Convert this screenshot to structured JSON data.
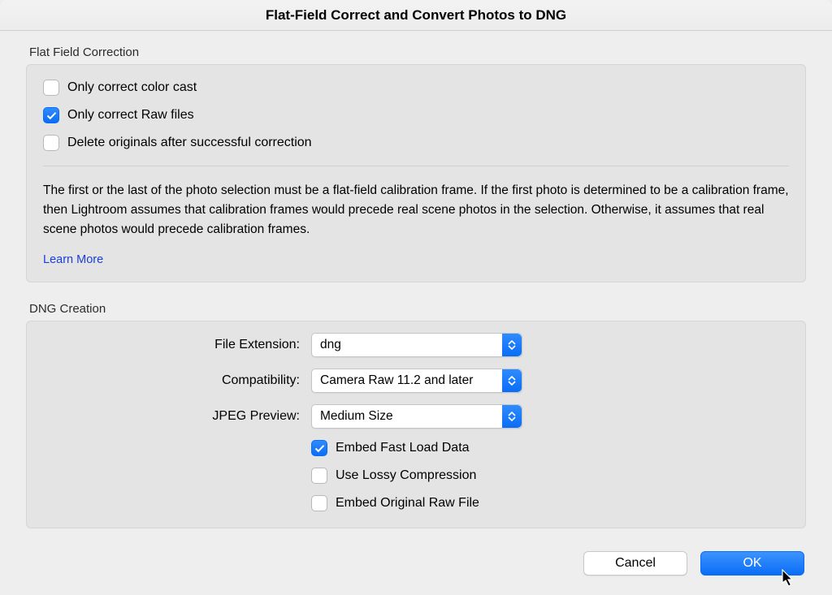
{
  "window": {
    "title": "Flat-Field Correct and Convert Photos to DNG"
  },
  "flat_field": {
    "group_label": "Flat Field Correction",
    "only_color_cast": {
      "label": "Only correct color cast",
      "checked": false
    },
    "only_raw": {
      "label": "Only correct Raw files",
      "checked": true
    },
    "delete_originals": {
      "label": "Delete originals after successful correction",
      "checked": false
    },
    "info": "The first or the last of the photo selection must be a flat-field calibration frame. If the first photo is determined to be a calibration frame, then Lightroom assumes that calibration frames would precede real scene photos in the selection. Otherwise, it assumes that real scene photos would precede calibration frames.",
    "learn_more": "Learn More"
  },
  "dng": {
    "group_label": "DNG Creation",
    "file_extension": {
      "label": "File Extension:",
      "value": "dng"
    },
    "compatibility": {
      "label": "Compatibility:",
      "value": "Camera Raw 11.2 and later"
    },
    "jpeg_preview": {
      "label": "JPEG Preview:",
      "value": "Medium Size"
    },
    "embed_fast_load": {
      "label": "Embed Fast Load Data",
      "checked": true
    },
    "use_lossy": {
      "label": "Use Lossy Compression",
      "checked": false
    },
    "embed_original": {
      "label": "Embed Original Raw File",
      "checked": false
    }
  },
  "buttons": {
    "cancel": "Cancel",
    "ok": "OK"
  }
}
